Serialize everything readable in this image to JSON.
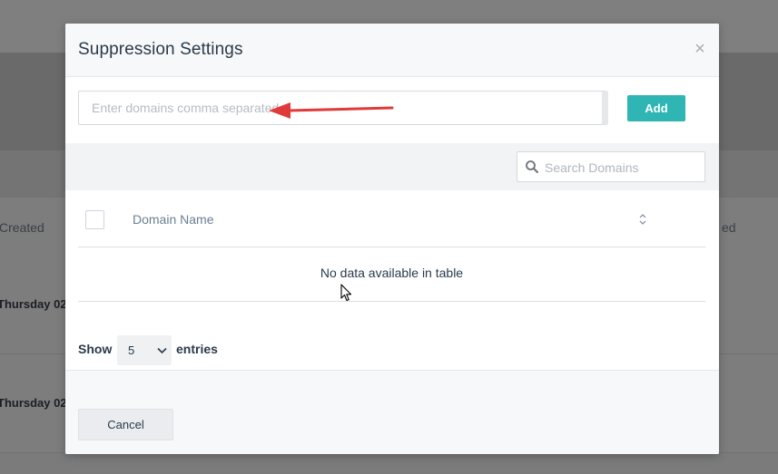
{
  "background": {
    "column_created": "Created",
    "column_right_partial": "ed",
    "row_1_partial": "Thursday 02",
    "row_2_partial": "Thursday 02"
  },
  "modal": {
    "title": "Suppression Settings",
    "close_symbol": "×",
    "domains_input": {
      "placeholder": "Enter domains comma separated",
      "value": ""
    },
    "add_label": "Add",
    "search": {
      "placeholder": "Search Domains",
      "value": ""
    },
    "table": {
      "columns": [
        "Domain Name"
      ],
      "empty_message": "No data available in table"
    },
    "length": {
      "show_label": "Show",
      "selected": "5",
      "entries_label": "entries"
    },
    "cancel_label": "Cancel"
  },
  "colors": {
    "accent": "#2fb6b4",
    "annotation_arrow": "#e03a3a"
  },
  "icons": [
    "close-icon",
    "search-icon",
    "sort-icon",
    "chevron-down-icon",
    "checkbox-icon",
    "annotation-arrow",
    "mouse-cursor"
  ]
}
